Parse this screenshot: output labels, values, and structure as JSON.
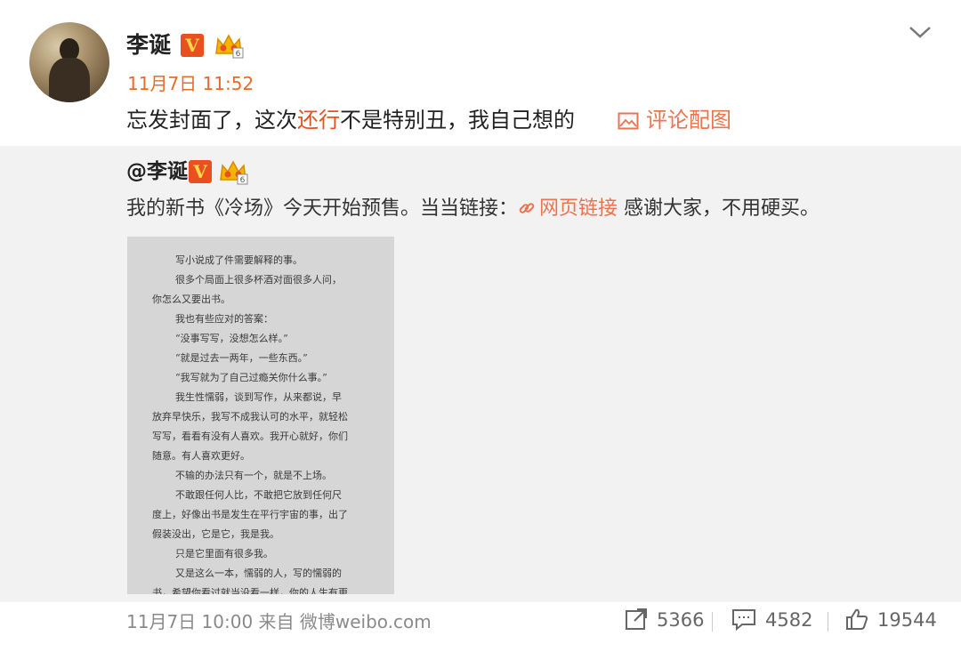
{
  "post": {
    "username": "李诞",
    "verified_badge": "V",
    "timestamp": "11月7日 11:52",
    "text_before": "忘发封面了，这次",
    "text_highlight": "还行",
    "text_after": "不是特别丑，我自己想的",
    "comment_with_image": "评论配图"
  },
  "repost": {
    "username": "@李诞",
    "verified_badge": "V",
    "text_before": "我的新书《冷场》今天开始预售。当当链接：",
    "link_label": "网页链接",
    "text_after": " 感谢大家，不用硬买。",
    "image_lines": [
      "写小说成了件需要解释的事。",
      "很多个局面上很多杯酒对面很多人问，",
      "你怎么又要出书。",
      "我也有些应对的答案：",
      "“没事写写，没想怎么样。”",
      "“就是过去一两年，一些东西。”",
      "“我写就为了自己过瘾关你什么事。”",
      "我生性懦弱，谈到写作，从来都说，早",
      "放弃早快乐，我写不成我认可的水平，就轻松",
      "写写，看看有没有人喜欢。我开心就好，你们",
      "随意。有人喜欢更好。",
      "不输的办法只有一个，就是不上场。",
      "不敢跟任何人比，不敢把它放到任何尺",
      "度上，好像出书是发生在平行宇宙的事，出了",
      "假装没出，它是它，我是我。",
      "只是它里面有很多我。",
      "又是这么一本，懦弱的人，写的懦弱的",
      "书，希望你看过就当没看一样，你的人生有更"
    ],
    "footer_time": "11月7日 10:00 来自 微博weibo.com",
    "reposts": "5366",
    "comments": "4582",
    "likes": "19544"
  },
  "icons": {
    "menu": "chevron-down-icon",
    "image": "image-icon",
    "link": "link-icon",
    "repost": "repost-icon",
    "comment": "comment-icon",
    "like": "thumbs-up-icon",
    "crown": "vip-crown-icon"
  },
  "colors": {
    "accent": "#e8501f",
    "link": "#eb7350",
    "repost_bg": "#f2f2f2"
  }
}
